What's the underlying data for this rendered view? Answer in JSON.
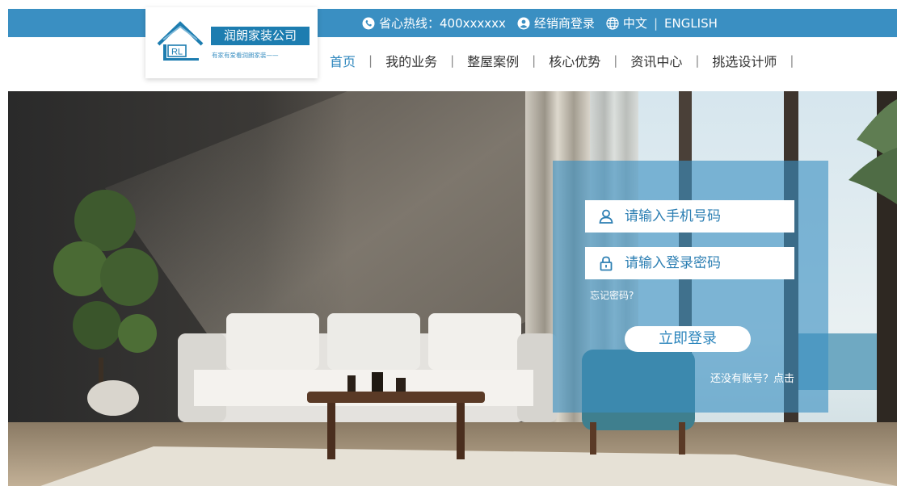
{
  "header": {
    "hotline_label": "省心热线：400xxxxxx",
    "dealer_login": "经销商登录",
    "lang_cn": "中文",
    "lang_en": "ENGLISH"
  },
  "logo": {
    "mark_text": "RL",
    "company_name": "润朗家装公司",
    "slogan": "有家有爱看润朗家装——"
  },
  "nav": {
    "items": [
      "首页",
      "我的业务",
      "整屋案例",
      "核心优势",
      "资讯中心",
      "挑选设计师"
    ],
    "active_index": 0
  },
  "login": {
    "phone_placeholder": "请输入手机号码",
    "password_placeholder": "请输入登录密码",
    "forgot": "忘记密码?",
    "submit": "立即登录",
    "register_prompt": "还没有账号？点击"
  },
  "colors": {
    "brand_blue": "#3a8fc2",
    "logo_blue": "#1d7db0"
  },
  "icons": [
    "phone-icon",
    "user-circle-icon",
    "globe-icon",
    "user-icon",
    "lock-icon",
    "house-logo-icon"
  ]
}
